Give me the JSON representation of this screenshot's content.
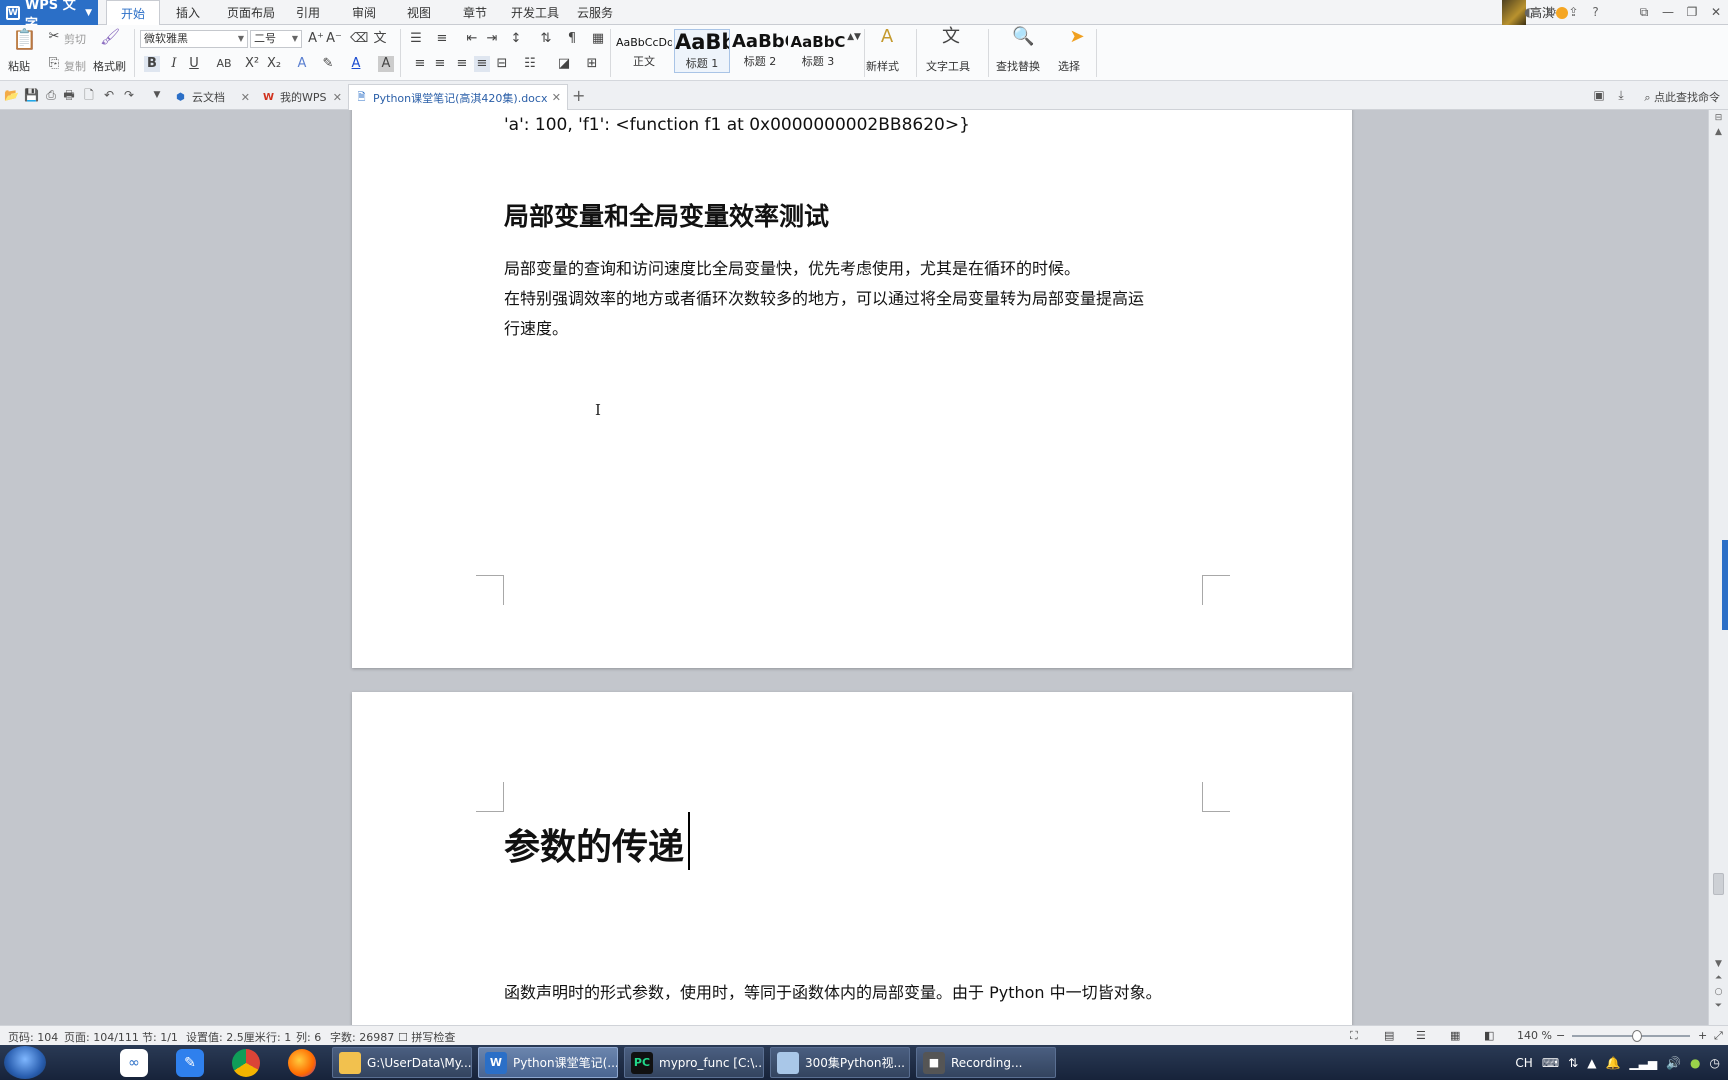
{
  "app": {
    "name": "WPS 文字"
  },
  "menu_tabs": [
    "开始",
    "插入",
    "页面布局",
    "引用",
    "审阅",
    "视图",
    "章节",
    "开发工具",
    "云服务"
  ],
  "user": {
    "name": "高淇"
  },
  "ribbon": {
    "paste": "粘贴",
    "cut": "剪切",
    "copy": "复制",
    "format_painter": "格式刷",
    "font_name": "微软雅黑",
    "font_size": "二号",
    "styles": [
      {
        "sample": "AaBbCcDd",
        "name": "正文"
      },
      {
        "sample": "AaBb",
        "name": "标题 1"
      },
      {
        "sample": "AaBbC",
        "name": "标题 2"
      },
      {
        "sample": "AaBbC",
        "name": "标题 3"
      }
    ],
    "new_style": "新样式",
    "text_tools": "文字工具",
    "find_replace": "查找替换",
    "select": "选择"
  },
  "doc_tabs": [
    {
      "label": "云文档"
    },
    {
      "label": "我的WPS"
    },
    {
      "label": "Python课堂笔记(高淇420集).docx"
    }
  ],
  "find_command": "点此查找命令",
  "document": {
    "code_line": "'a': 100, 'f1': <function f1 at 0x0000000002BB8620>}",
    "heading2": "局部变量和全局变量效率测试",
    "para1": "局部变量的查询和访问速度比全局变量快，优先考虑使用，尤其是在循环的时候。",
    "para2a": "在特别强调效率的地方或者循环次数较多的地方，可以通过将全局变量转为局部变量提高运",
    "para2b": "行速度。",
    "heading1": "参数的传递",
    "para3": "函数声明时的形式参数，使用时，等同于函数体内的局部变量。由于 Python 中一切皆对象。"
  },
  "status": {
    "page_no": "页码: 104",
    "pages": "页面: 104/111",
    "section": "节: 1/1",
    "setting": "设置值: 2.5厘米",
    "row": "行: 1",
    "col": "列: 6",
    "words": "字数: 26987",
    "spell": "拼写检查",
    "zoom": "140 %"
  },
  "taskbar": {
    "items": [
      {
        "label": "G:\\UserData\\My..."
      },
      {
        "label": "Python课堂笔记(..."
      },
      {
        "label": "mypro_func [C:\\..."
      },
      {
        "label": "300集Python视..."
      },
      {
        "label": "Recording..."
      }
    ],
    "ime": "CH"
  },
  "colors": {
    "accent": "#2b6fc7",
    "page": "#ffffff",
    "workspace": "#c3c6cc"
  }
}
